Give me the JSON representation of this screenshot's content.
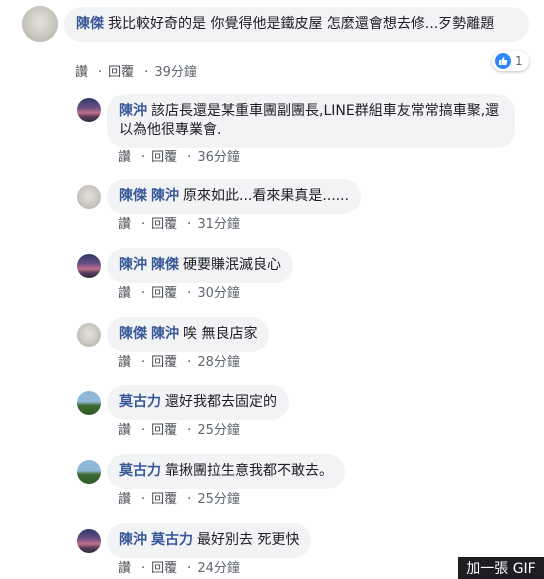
{
  "labels": {
    "like": "讚",
    "reply": "回覆",
    "dot": "·"
  },
  "root": {
    "author": "陳傑",
    "text": "我比較好奇的是 你覺得他是鐵皮屋 怎麼還會想去修...歹勢離題",
    "time": "39分鐘",
    "reaction_count": "1"
  },
  "replies": [
    {
      "author": "陳沖",
      "tag": "",
      "text": "該店長還是某重車團副團長,LINE群組車友常常搞車聚,還以為他很專業會.",
      "time": "36分鐘",
      "avatar": "sunset"
    },
    {
      "author": "陳傑",
      "tag": "陳沖",
      "text": "原來如此...看來果真是......",
      "time": "31分鐘",
      "avatar": "gray"
    },
    {
      "author": "陳沖",
      "tag": "陳傑",
      "text": "硬要賺泯滅良心",
      "time": "30分鐘",
      "avatar": "sunset"
    },
    {
      "author": "陳傑",
      "tag": "陳沖",
      "text": "唉 無良店家",
      "time": "28分鐘",
      "avatar": "gray"
    },
    {
      "author": "莫古力",
      "tag": "",
      "text": "還好我都去固定的",
      "time": "25分鐘",
      "avatar": "tree"
    },
    {
      "author": "莫古力",
      "tag": "",
      "text": "靠揪團拉生意我都不敢去。",
      "time": "25分鐘",
      "avatar": "tree"
    },
    {
      "author": "陳沖",
      "tag": "莫古力",
      "text": "最好別去 死更快",
      "time": "24分鐘",
      "avatar": "sunset"
    }
  ],
  "gif_badge": "加一張 GIF",
  "colors": {
    "name": "#385898",
    "bubble": "#f2f3f5",
    "like": "#2d88ff"
  }
}
